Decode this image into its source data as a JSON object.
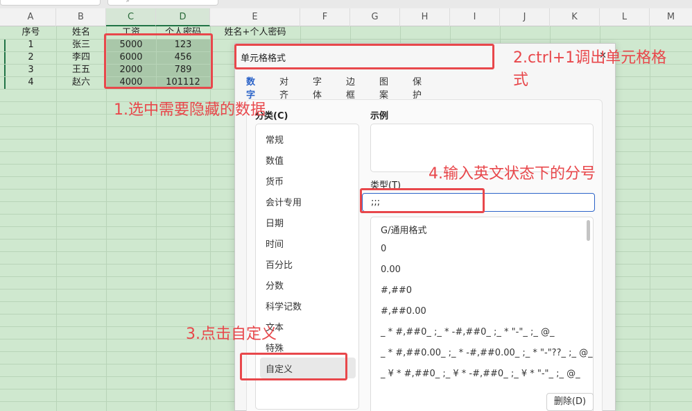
{
  "columns": [
    "A",
    "B",
    "C",
    "D",
    "E",
    "F",
    "G",
    "H",
    "I",
    "J",
    "K",
    "L",
    "M"
  ],
  "sheet": {
    "header": [
      "序号",
      "姓名",
      "工资",
      "个人密码",
      "姓名+个人密码"
    ],
    "rows": [
      [
        "1",
        "张三",
        "5000",
        "123"
      ],
      [
        "2",
        "李四",
        "6000",
        "456"
      ],
      [
        "3",
        "王五",
        "2000",
        "789"
      ],
      [
        "4",
        "赵六",
        "4000",
        "101112"
      ]
    ]
  },
  "annotations": {
    "step1": "1.选中需要隐藏的数据",
    "step2_line1": "2.ctrl+1调出单元格格",
    "step2_line2": "式",
    "step3": "3.点击自定义",
    "step4": "4.输入英文状态下的分号"
  },
  "dialog": {
    "title": "单元格格式",
    "close": "✕",
    "tabs": [
      "数字",
      "对齐",
      "字体",
      "边框",
      "图案",
      "保护"
    ],
    "active_tab": "数字",
    "category_label": "分类(C)",
    "categories": [
      "常规",
      "数值",
      "货币",
      "会计专用",
      "日期",
      "时间",
      "百分比",
      "分数",
      "科学记数",
      "文本",
      "特殊",
      "自定义"
    ],
    "selected_category": "自定义",
    "sample_label": "示例",
    "type_label": "类型(T)",
    "type_value": ";;;",
    "formats": [
      "G/通用格式",
      "0",
      "0.00",
      "#,##0",
      "#,##0.00",
      "_ * #,##0_ ;_ * -#,##0_ ;_ * \"-\"_ ;_ @_",
      "_ * #,##0.00_ ;_ * -#,##0.00_ ;_ * \"-\"??_ ;_ @_",
      "_ ¥ * #,##0_ ;_ ¥ * -#,##0_ ;_ ¥ * \"-\"_ ;_ @_"
    ],
    "delete_button": "删除(D)"
  },
  "colors": {
    "grid_background": "#cfe8cf",
    "annotation_red": "#e8474b",
    "accent_blue": "#2b63c8",
    "selection": "#a9c7a9"
  }
}
